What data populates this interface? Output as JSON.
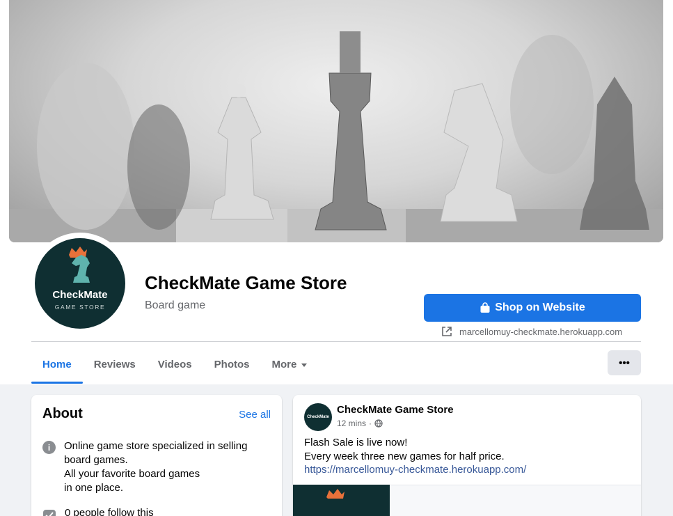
{
  "page": {
    "name": "CheckMate Game Store",
    "category": "Board game",
    "logo_title": "CheckMate",
    "logo_subtitle": "GAME STORE",
    "cta_label": "Shop on Website",
    "website": "marcellomuy-checkmate.herokuapp.com"
  },
  "tabs": [
    {
      "label": "Home",
      "active": true
    },
    {
      "label": "Reviews"
    },
    {
      "label": "Videos"
    },
    {
      "label": "Photos"
    },
    {
      "label": "More"
    }
  ],
  "more_button": "•••",
  "about": {
    "title": "About",
    "see_all": "See all",
    "description": "Online game store specialized in selling\nboard games.\nAll your favorite board games\nin one place.",
    "followers": "0 people follow this"
  },
  "post": {
    "author": "CheckMate Game Store",
    "avatar_text": "CheckMate",
    "time": "12 mins",
    "separator": "·",
    "text": "Flash Sale is live now!\nEvery week three new games for half price.",
    "link": "https://marcellomuy-checkmate.herokuapp.com/"
  },
  "icons": {
    "cta": "shopping-bag-icon",
    "website": "external-link-icon",
    "info": "info-icon",
    "followers": "followers-icon",
    "audience": "globe-icon"
  },
  "colors": {
    "accent": "#1b74e4",
    "brand_dark": "#0f2f32",
    "crown": "#e8713a",
    "knight": "#5fb3ad"
  }
}
